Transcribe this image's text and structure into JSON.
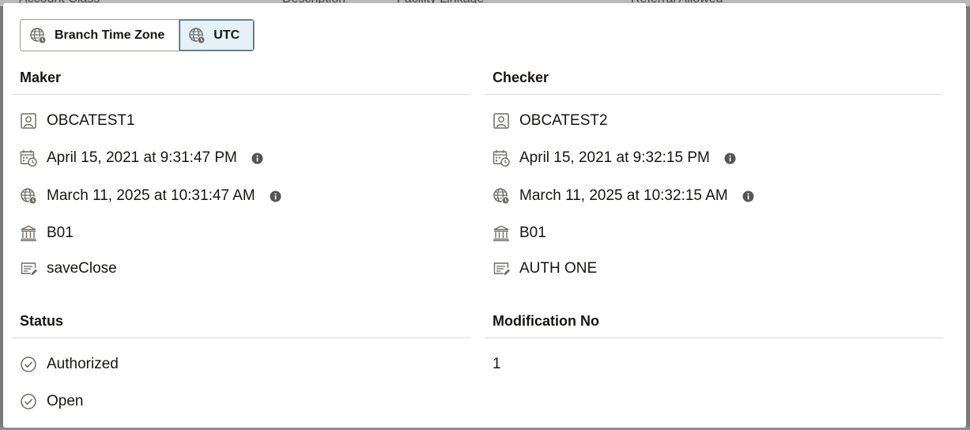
{
  "background_headers": [
    "Account Class",
    "Description",
    "Facility Linkage",
    "Referral Allowed"
  ],
  "timezone_toggle": {
    "options": [
      {
        "label": "Branch Time Zone",
        "icon": "globe-clock-icon",
        "selected": false
      },
      {
        "label": "UTC",
        "icon": "globe-clock-icon",
        "selected": true
      }
    ]
  },
  "maker": {
    "title": "Maker",
    "user": "OBCATEST1",
    "datetime": "April 15, 2021 at 9:31:47 PM",
    "utc_datetime": "March 11, 2025 at 10:31:47 AM",
    "branch": "B01",
    "remarks": "saveClose"
  },
  "checker": {
    "title": "Checker",
    "user": "OBCATEST2",
    "datetime": "April 15, 2021 at 9:32:15 PM",
    "utc_datetime": "March 11, 2025 at 10:32:15 AM",
    "branch": "B01",
    "remarks": "AUTH ONE"
  },
  "status": {
    "title": "Status",
    "auth_status": "Authorized",
    "record_status": "Open"
  },
  "modification": {
    "title": "Modification No",
    "value": "1"
  },
  "colors": {
    "text": "#161513",
    "icon": "#6f6b66",
    "selected_bg": "#e4f1f7",
    "selected_border": "#2c6a8a"
  }
}
